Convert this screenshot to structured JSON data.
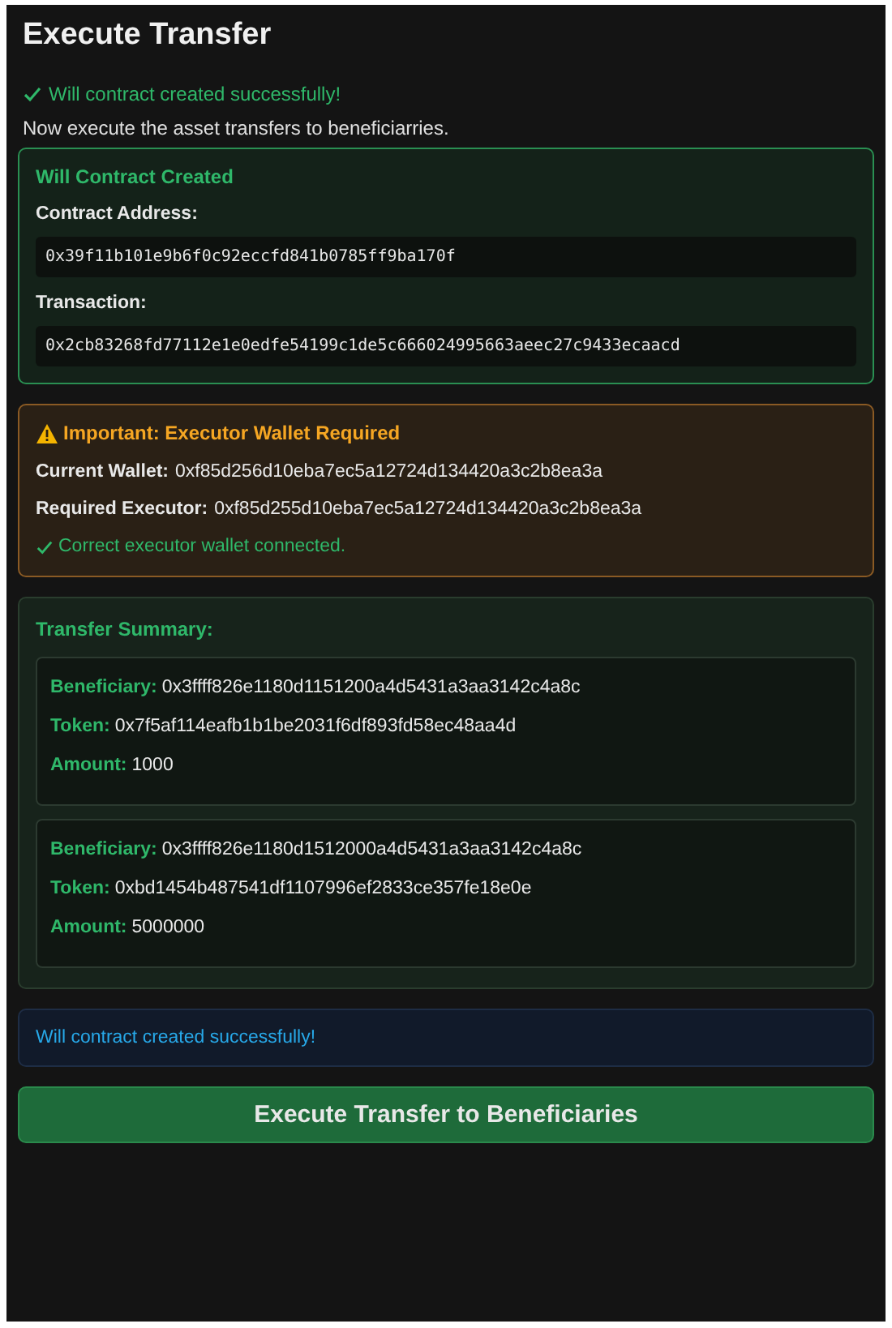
{
  "page": {
    "title": "Execute Transfer"
  },
  "success_message": "Will contract created successfully!",
  "instruction": "Now execute the asset transfers to beneficiarries.",
  "contract_card": {
    "title": "Will Contract Created",
    "fields": [
      {
        "label": "Contract Address:",
        "value": "0x39f11b101e9b6f0c92eccfd841b0785ff9ba170f"
      },
      {
        "label": "Transaction:",
        "value": "0x2cb83268fd77112e1e0edfe54199c1de5c666024995663aeec27c9433ecaacd"
      }
    ]
  },
  "executor_warning": {
    "title": "Important: Executor Wallet Required",
    "rows": [
      {
        "label": "Current Wallet:",
        "value": "0xf85d256d10eba7ec5a12724d134420a3c2b8ea3a"
      },
      {
        "label": "Required Executor:",
        "value": "0xf85d255d10eba7ec5a12724d134420a3c2b8ea3a"
      }
    ],
    "status": "Correct executor wallet connected."
  },
  "transfer_summary": {
    "title": "Transfer Summary:",
    "transfers": [
      {
        "fields": [
          {
            "label": "Beneficiary:",
            "value": "0x3ffff826e1180d1151200a4d5431a3aa3142c4a8c"
          },
          {
            "label": "Token:",
            "value": "0x7f5af114eafb1b1be2031f6df893fd58ec48aa4d"
          },
          {
            "label": "Amount:",
            "value": "1000"
          }
        ]
      },
      {
        "fields": [
          {
            "label": "Beneficiary:",
            "value": "0x3ffff826e1180d1512000a4d5431a3aa3142c4a8c"
          },
          {
            "label": "Token:",
            "value": "0xbd1454b487541df1107996ef2833ce357fe18e0e"
          },
          {
            "label": "Amount:",
            "value": "5000000"
          }
        ]
      }
    ]
  },
  "info_message": "Will contract created successfully!",
  "button": "Execute Transfer to Beneficiaries"
}
